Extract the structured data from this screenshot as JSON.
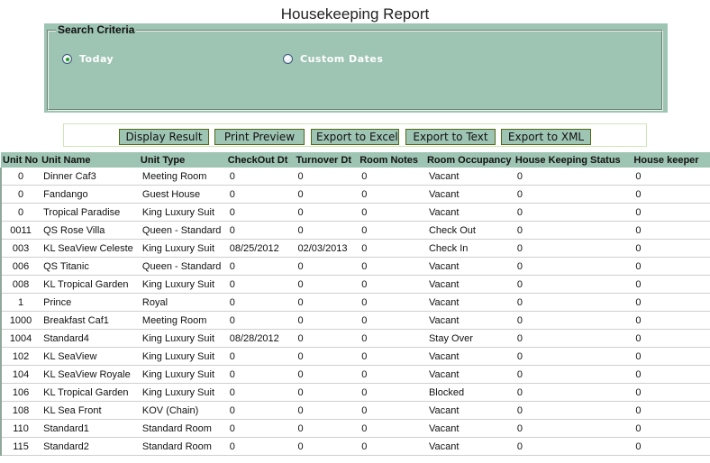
{
  "page": {
    "title": "Housekeeping Report"
  },
  "search_criteria": {
    "legend": "Search Criteria",
    "options": [
      {
        "label": "Today",
        "checked": true
      },
      {
        "label": "Custom Dates",
        "checked": false
      }
    ]
  },
  "toolbar": {
    "buttons": [
      {
        "label": "Display Result"
      },
      {
        "label": "Print Preview"
      },
      {
        "label": "Export to Excel"
      },
      {
        "label": "Export to Text"
      },
      {
        "label": "Export to XML"
      }
    ]
  },
  "table": {
    "columns": [
      "Unit No",
      "Unit Name",
      "Unit Type",
      "CheckOut Dt",
      "Turnover Dt",
      "Room Notes",
      "Room Occupancy",
      "House Keeping Status",
      "House keeper"
    ],
    "rows": [
      [
        "0",
        "Dinner Caf3",
        "Meeting Room",
        "0",
        "0",
        "0",
        "Vacant",
        "0",
        "0"
      ],
      [
        "0",
        "Fandango",
        "Guest House",
        "0",
        "0",
        "0",
        "Vacant",
        "0",
        "0"
      ],
      [
        "0",
        "Tropical Paradise",
        "King Luxury Suit",
        "0",
        "0",
        "0",
        "Vacant",
        "0",
        "0"
      ],
      [
        "0011",
        "QS Rose Villa",
        "Queen - Standard",
        "0",
        "0",
        "0",
        "Check Out",
        "0",
        "0"
      ],
      [
        "003",
        "KL SeaView Celeste",
        "King Luxury Suit",
        "08/25/2012",
        "02/03/2013",
        "0",
        "Check In",
        "0",
        "0"
      ],
      [
        "006",
        "QS Titanic",
        "Queen - Standard",
        "0",
        "0",
        "0",
        "Vacant",
        "0",
        "0"
      ],
      [
        "008",
        "KL Tropical Garden",
        "King Luxury Suit",
        "0",
        "0",
        "0",
        "Vacant",
        "0",
        "0"
      ],
      [
        "1",
        "Prince",
        "Royal",
        "0",
        "0",
        "0",
        "Vacant",
        "0",
        "0"
      ],
      [
        "1000",
        "Breakfast Caf1",
        "Meeting Room",
        "0",
        "0",
        "0",
        "Vacant",
        "0",
        "0"
      ],
      [
        "1004",
        "Standard4",
        "King Luxury Suit",
        "08/28/2012",
        "0",
        "0",
        "Stay Over",
        "0",
        "0"
      ],
      [
        "102",
        "KL SeaView",
        "King Luxury Suit",
        "0",
        "0",
        "0",
        "Vacant",
        "0",
        "0"
      ],
      [
        "104",
        "KL SeaView Royale",
        "King Luxury Suit",
        "0",
        "0",
        "0",
        "Vacant",
        "0",
        "0"
      ],
      [
        "106",
        "KL Tropical Garden",
        "King Luxury Suit",
        "0",
        "0",
        "0",
        "Blocked",
        "0",
        "0"
      ],
      [
        "108",
        "KL Sea Front",
        "KOV (Chain)",
        "0",
        "0",
        "0",
        "Vacant",
        "0",
        "0"
      ],
      [
        "110",
        "Standard1",
        "Standard Room",
        "0",
        "0",
        "0",
        "Vacant",
        "0",
        "0"
      ],
      [
        "115",
        "Standard2",
        "Standard Room",
        "0",
        "0",
        "0",
        "Vacant",
        "0",
        "0"
      ]
    ]
  }
}
